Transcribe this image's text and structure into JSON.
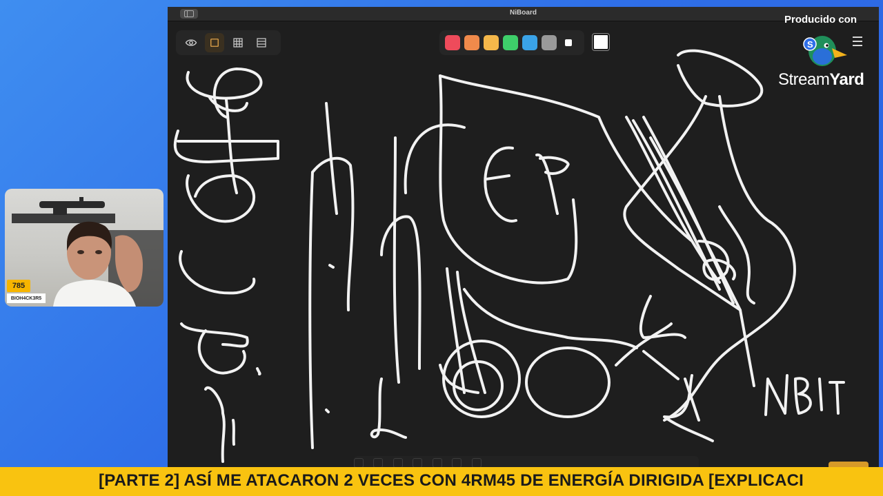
{
  "app": {
    "title": "NiBoard"
  },
  "toolbar": {
    "tools": [
      {
        "name": "eye-icon",
        "active": false
      },
      {
        "name": "square-icon",
        "active": true
      },
      {
        "name": "grid-icon",
        "active": false
      },
      {
        "name": "rows-icon",
        "active": false
      }
    ],
    "palette": [
      "#ee4b5b",
      "#f08a4b",
      "#f5b84a",
      "#3ecf6a",
      "#3aa3e8",
      "#9a9a9a"
    ],
    "selected_color": "#ffffff"
  },
  "canvas": {
    "handwriting": "NBIT"
  },
  "branding": {
    "produced_label": "Producido con",
    "brand_regular": "Stream",
    "brand_bold": "Yard"
  },
  "webcam": {
    "viewer_count": "785",
    "name_tag": "BIOH4CK3R5"
  },
  "ticker": {
    "text": "[PARTE 2] ASÍ ME ATACARON 2 VECES CON 4RM45 DE ENERGÍA DIRIGIDA [EXPLICACI"
  }
}
